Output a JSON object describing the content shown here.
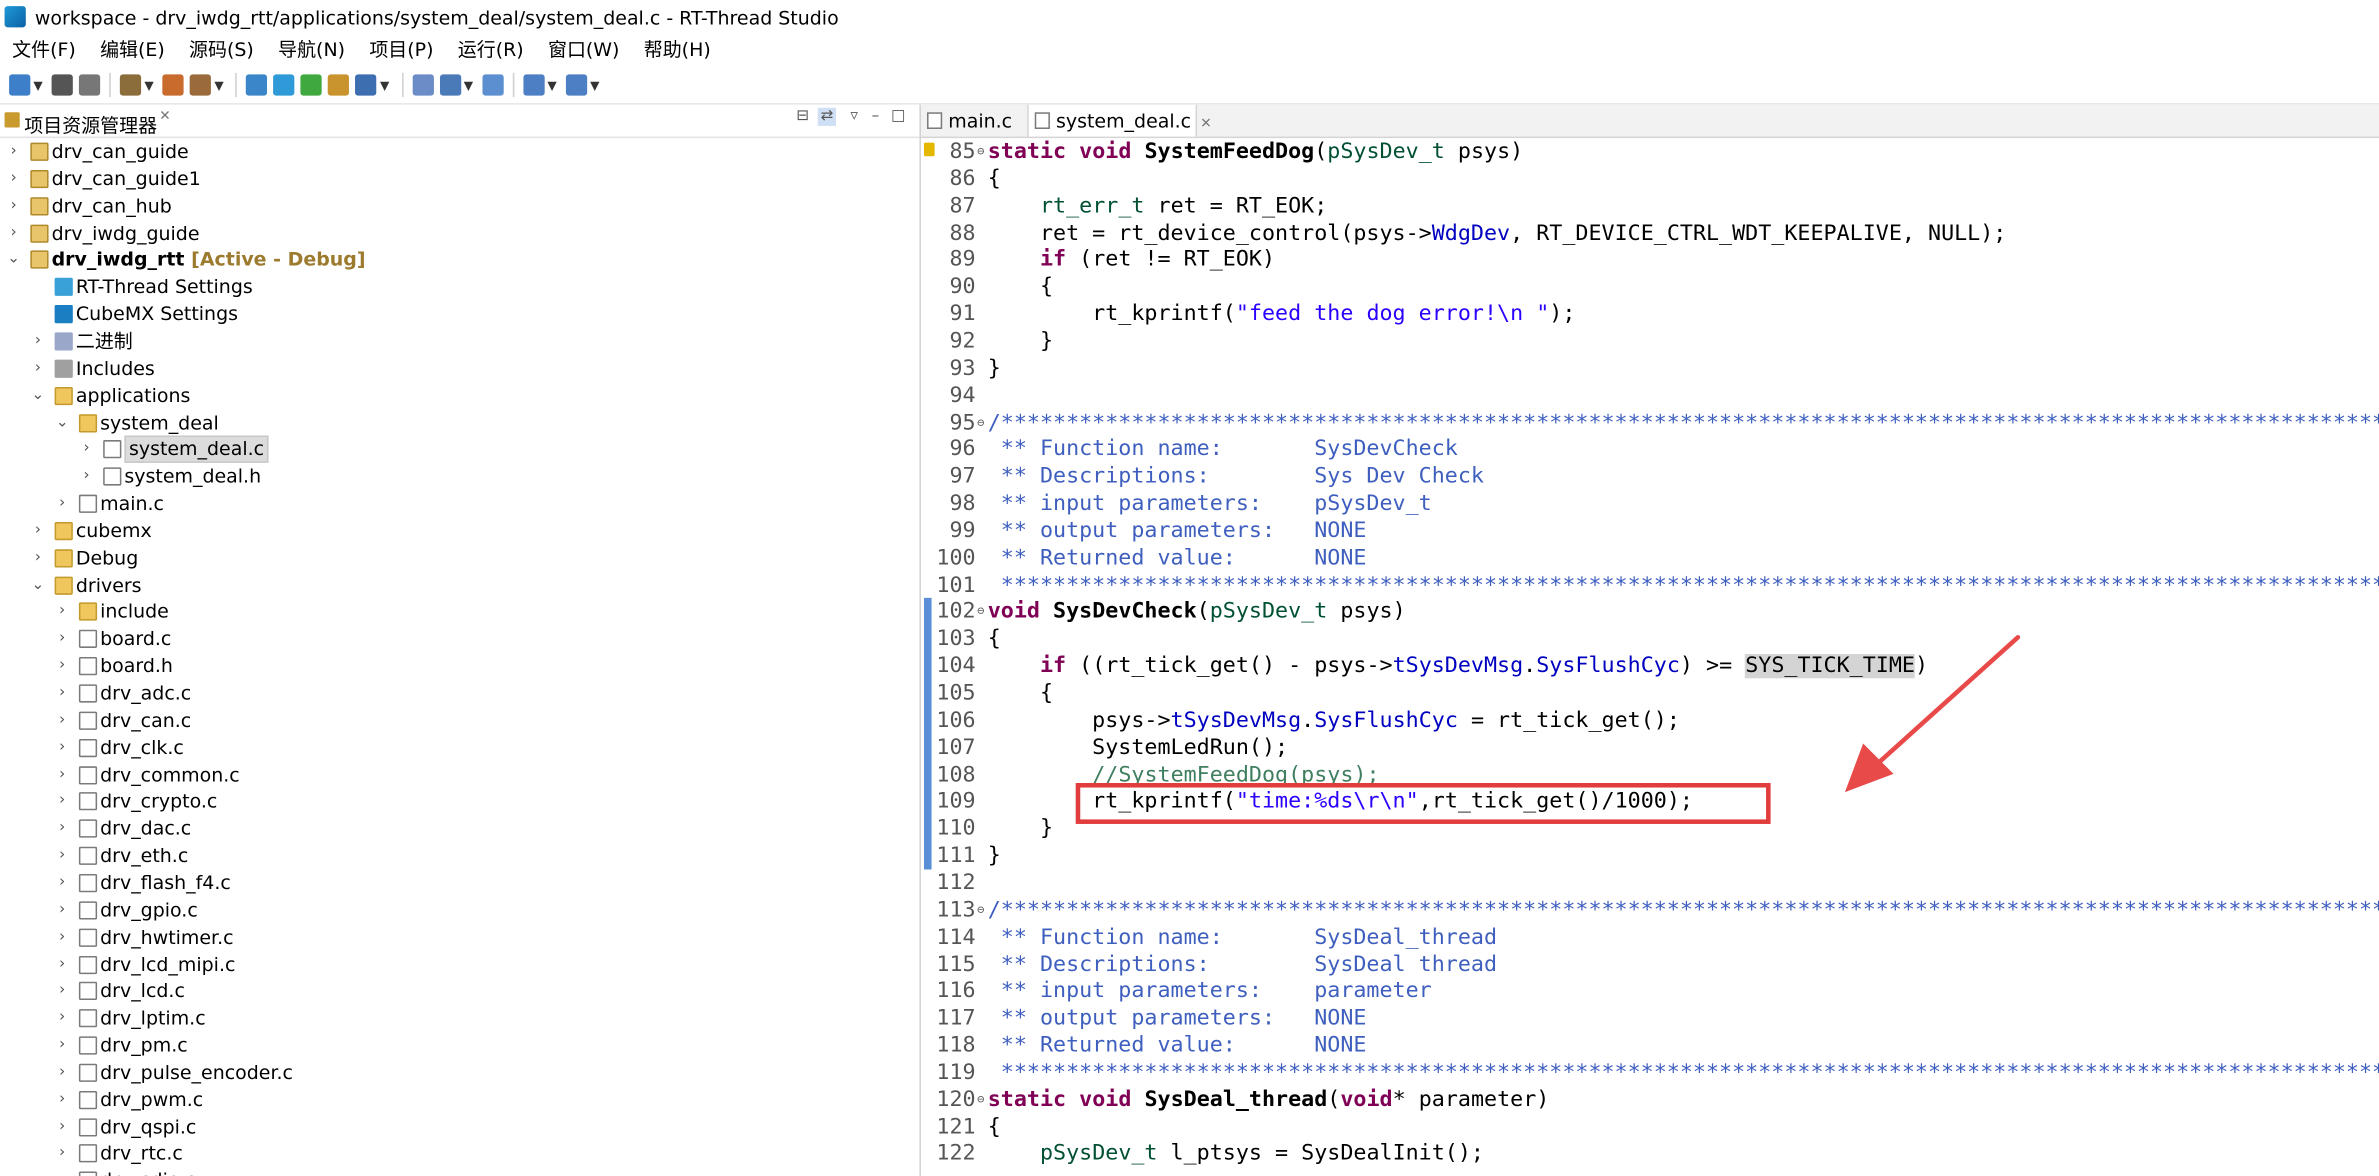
{
  "window": {
    "title": "workspace - drv_iwdg_rtt/applications/system_deal/system_deal.c - RT-Thread Studio"
  },
  "menu": [
    "文件(F)",
    "编辑(E)",
    "源码(S)",
    "导航(N)",
    "项目(P)",
    "运行(R)",
    "窗口(W)",
    "帮助(H)"
  ],
  "explorer": {
    "title": "项目资源管理器",
    "items": [
      {
        "label": "drv_can_guide",
        "icon": "project-icon",
        "level": 0,
        "arrow": "›"
      },
      {
        "label": "drv_can_guide1",
        "icon": "project-icon",
        "level": 0,
        "arrow": "›"
      },
      {
        "label": "drv_can_hub",
        "icon": "project-icon",
        "level": 0,
        "arrow": "›"
      },
      {
        "label": "drv_iwdg_guide",
        "icon": "project-icon",
        "level": 0,
        "arrow": "›"
      },
      {
        "label": "drv_iwdg_rtt",
        "icon": "project-icon",
        "level": 0,
        "arrow": "⌄",
        "tag": "[Active - Debug]"
      },
      {
        "label": "RT-Thread Settings",
        "icon": "rt-settings-icon",
        "level": 1,
        "arrow": ""
      },
      {
        "label": "CubeMX Settings",
        "icon": "cubemx-settings-icon",
        "level": 1,
        "arrow": ""
      },
      {
        "label": "二进制",
        "icon": "binaries-icon",
        "level": 1,
        "arrow": "›"
      },
      {
        "label": "Includes",
        "icon": "includes-icon",
        "level": 1,
        "arrow": "›"
      },
      {
        "label": "applications",
        "icon": "folder-icon",
        "level": 1,
        "arrow": "⌄"
      },
      {
        "label": "system_deal",
        "icon": "folder-icon",
        "level": 2,
        "arrow": "⌄"
      },
      {
        "label": "system_deal.c",
        "icon": "c-file-icon",
        "level": 3,
        "arrow": "›",
        "selected": true
      },
      {
        "label": "system_deal.h",
        "icon": "h-file-icon",
        "level": 3,
        "arrow": "›"
      },
      {
        "label": "main.c",
        "icon": "c-file-icon",
        "level": 2,
        "arrow": "›"
      },
      {
        "label": "cubemx",
        "icon": "folder-icon",
        "level": 1,
        "arrow": "›"
      },
      {
        "label": "Debug",
        "icon": "folder-icon",
        "level": 1,
        "arrow": "›"
      },
      {
        "label": "drivers",
        "icon": "folder-icon",
        "level": 1,
        "arrow": "⌄"
      },
      {
        "label": "include",
        "icon": "folder-icon",
        "level": 2,
        "arrow": "›"
      },
      {
        "label": "board.c",
        "icon": "c-file-icon",
        "level": 2,
        "arrow": "›"
      },
      {
        "label": "board.h",
        "icon": "h-file-icon",
        "level": 2,
        "arrow": "›"
      },
      {
        "label": "drv_adc.c",
        "icon": "c-file-icon",
        "level": 2,
        "arrow": "›"
      },
      {
        "label": "drv_can.c",
        "icon": "c-file-icon",
        "level": 2,
        "arrow": "›"
      },
      {
        "label": "drv_clk.c",
        "icon": "c-file-icon",
        "level": 2,
        "arrow": "›"
      },
      {
        "label": "drv_common.c",
        "icon": "c-file-icon",
        "level": 2,
        "arrow": "›"
      },
      {
        "label": "drv_crypto.c",
        "icon": "c-file-icon",
        "level": 2,
        "arrow": "›"
      },
      {
        "label": "drv_dac.c",
        "icon": "c-file-icon",
        "level": 2,
        "arrow": "›"
      },
      {
        "label": "drv_eth.c",
        "icon": "c-file-icon",
        "level": 2,
        "arrow": "›"
      },
      {
        "label": "drv_flash_f4.c",
        "icon": "c-file-icon",
        "level": 2,
        "arrow": "›"
      },
      {
        "label": "drv_gpio.c",
        "icon": "c-file-icon",
        "level": 2,
        "arrow": "›"
      },
      {
        "label": "drv_hwtimer.c",
        "icon": "c-file-icon",
        "level": 2,
        "arrow": "›"
      },
      {
        "label": "drv_lcd_mipi.c",
        "icon": "c-file-icon",
        "level": 2,
        "arrow": "›"
      },
      {
        "label": "drv_lcd.c",
        "icon": "c-file-icon",
        "level": 2,
        "arrow": "›"
      },
      {
        "label": "drv_lptim.c",
        "icon": "c-file-icon",
        "level": 2,
        "arrow": "›"
      },
      {
        "label": "drv_pm.c",
        "icon": "c-file-icon",
        "level": 2,
        "arrow": "›"
      },
      {
        "label": "drv_pulse_encoder.c",
        "icon": "c-file-icon",
        "level": 2,
        "arrow": "›"
      },
      {
        "label": "drv_pwm.c",
        "icon": "c-file-icon",
        "level": 2,
        "arrow": "›"
      },
      {
        "label": "drv_qspi.c",
        "icon": "c-file-icon",
        "level": 2,
        "arrow": "›"
      },
      {
        "label": "drv_rtc.c",
        "icon": "c-file-icon",
        "level": 2,
        "arrow": "›"
      },
      {
        "label": "drv_sdio.c",
        "icon": "c-file-icon",
        "level": 2,
        "arrow": "›"
      }
    ]
  },
  "editor": {
    "tabs": [
      {
        "label": "main.c",
        "active": false
      },
      {
        "label": "system_deal.c",
        "active": true
      }
    ],
    "lines": [
      {
        "n": "85",
        "fold": "⊖",
        "warn": true,
        "s": [
          [
            "kw",
            "static "
          ],
          [
            "kw",
            "void "
          ],
          [
            "fn",
            "SystemFeedDog"
          ],
          [
            "",
            "("
          ],
          [
            "ty",
            "pSysDev_t"
          ],
          [
            "",
            " psys)"
          ]
        ]
      },
      {
        "n": "86",
        "s": [
          [
            "",
            "{"
          ]
        ]
      },
      {
        "n": "87",
        "s": [
          [
            "",
            "    "
          ],
          [
            "ty",
            "rt_err_t"
          ],
          [
            "",
            " ret = RT_EOK;"
          ]
        ]
      },
      {
        "n": "88",
        "s": [
          [
            "",
            "    ret = rt_device_control(psys->"
          ],
          [
            "mv",
            "WdgDev"
          ],
          [
            "",
            ", RT_DEVICE_CTRL_WDT_KEEPALIVE, NULL);"
          ]
        ]
      },
      {
        "n": "89",
        "s": [
          [
            "",
            "    "
          ],
          [
            "kw",
            "if"
          ],
          [
            "",
            " (ret != RT_EOK)"
          ]
        ]
      },
      {
        "n": "90",
        "s": [
          [
            "",
            "    {"
          ]
        ]
      },
      {
        "n": "91",
        "s": [
          [
            "",
            "        rt_kprintf("
          ],
          [
            "st",
            "\"feed the dog error!\\n \""
          ],
          [
            "",
            ");"
          ]
        ]
      },
      {
        "n": "92",
        "s": [
          [
            "",
            "    }"
          ]
        ]
      },
      {
        "n": "93",
        "s": [
          [
            "",
            "}"
          ]
        ]
      },
      {
        "n": "94",
        "s": [
          [
            "",
            ""
          ]
        ]
      },
      {
        "n": "95",
        "fold": "⊖",
        "s": [
          [
            "cm",
            "/***************************************************************************************************************"
          ]
        ]
      },
      {
        "n": "96",
        "s": [
          [
            "cm",
            " ** Function name:       SysDevCheck"
          ]
        ]
      },
      {
        "n": "97",
        "s": [
          [
            "cm",
            " ** Descriptions:        Sys Dev Check"
          ]
        ]
      },
      {
        "n": "98",
        "s": [
          [
            "cm",
            " ** input parameters:    pSysDev_t"
          ]
        ]
      },
      {
        "n": "99",
        "s": [
          [
            "cm",
            " ** output parameters:   NONE"
          ]
        ]
      },
      {
        "n": "100",
        "s": [
          [
            "cm",
            " ** Returned value:      NONE"
          ]
        ]
      },
      {
        "n": "101",
        "s": [
          [
            "cm",
            " ***************************************************************************************************************/"
          ]
        ]
      },
      {
        "n": "102",
        "fold": "⊖",
        "s": [
          [
            "kw",
            "void "
          ],
          [
            "fn",
            "SysDevCheck"
          ],
          [
            "",
            "("
          ],
          [
            "ty",
            "pSysDev_t"
          ],
          [
            "",
            " psys)"
          ]
        ]
      },
      {
        "n": "103",
        "s": [
          [
            "",
            "{"
          ]
        ]
      },
      {
        "n": "104",
        "s": [
          [
            "",
            "    "
          ],
          [
            "kw",
            "if"
          ],
          [
            "",
            " ((rt_tick_get() - psys->"
          ],
          [
            "mv",
            "tSysDevMsg"
          ],
          [
            "",
            "."
          ],
          [
            "mv",
            "SysFlushCyc"
          ],
          [
            "",
            ") >= "
          ],
          [
            "mark",
            "SYS_TICK_TIME"
          ],
          [
            "",
            ")"
          ]
        ]
      },
      {
        "n": "105",
        "s": [
          [
            "",
            "    {"
          ]
        ]
      },
      {
        "n": "106",
        "s": [
          [
            "",
            "        psys->"
          ],
          [
            "mv",
            "tSysDevMsg"
          ],
          [
            "",
            "."
          ],
          [
            "mv",
            "SysFlushCyc"
          ],
          [
            "",
            " = rt_tick_get();"
          ]
        ]
      },
      {
        "n": "107",
        "s": [
          [
            "",
            "        SystemLedRun();"
          ]
        ]
      },
      {
        "n": "108",
        "s": [
          [
            "",
            "        "
          ],
          [
            "lc",
            "//SystemFeedDog(psys);"
          ]
        ]
      },
      {
        "n": "109",
        "s": [
          [
            "",
            "        rt_kprintf("
          ],
          [
            "st",
            "\"time:%ds\\r\\n\""
          ],
          [
            "",
            ",rt_tick_get()/1000);"
          ]
        ]
      },
      {
        "n": "110",
        "s": [
          [
            "",
            "    }"
          ]
        ]
      },
      {
        "n": "111",
        "s": [
          [
            "",
            "}"
          ]
        ]
      },
      {
        "n": "112",
        "s": [
          [
            "",
            ""
          ]
        ]
      },
      {
        "n": "113",
        "fold": "⊖",
        "s": [
          [
            "cm",
            "/***************************************************************************************************************"
          ]
        ]
      },
      {
        "n": "114",
        "s": [
          [
            "cm",
            " ** Function name:       SysDeal_thread"
          ]
        ]
      },
      {
        "n": "115",
        "s": [
          [
            "cm",
            " ** Descriptions:        SysDeal thread"
          ]
        ]
      },
      {
        "n": "116",
        "s": [
          [
            "cm",
            " ** input parameters:    parameter"
          ]
        ]
      },
      {
        "n": "117",
        "s": [
          [
            "cm",
            " ** output parameters:   NONE"
          ]
        ]
      },
      {
        "n": "118",
        "s": [
          [
            "cm",
            " ** Returned value:      NONE"
          ]
        ]
      },
      {
        "n": "119",
        "s": [
          [
            "cm",
            " ***************************************************************************************************************/"
          ]
        ]
      },
      {
        "n": "120",
        "fold": "⊖",
        "s": [
          [
            "kw",
            "static "
          ],
          [
            "kw",
            "void "
          ],
          [
            "fn",
            "SysDeal_thread"
          ],
          [
            "",
            "("
          ],
          [
            "kw",
            "void"
          ],
          [
            "",
            "* parameter)"
          ]
        ]
      },
      {
        "n": "121",
        "s": [
          [
            "",
            "{"
          ]
        ]
      },
      {
        "n": "122",
        "s": [
          [
            "",
            "    "
          ],
          [
            "ty",
            "pSysDev_t"
          ],
          [
            "",
            " l_ptsys = SysDealInit();"
          ]
        ]
      }
    ]
  }
}
